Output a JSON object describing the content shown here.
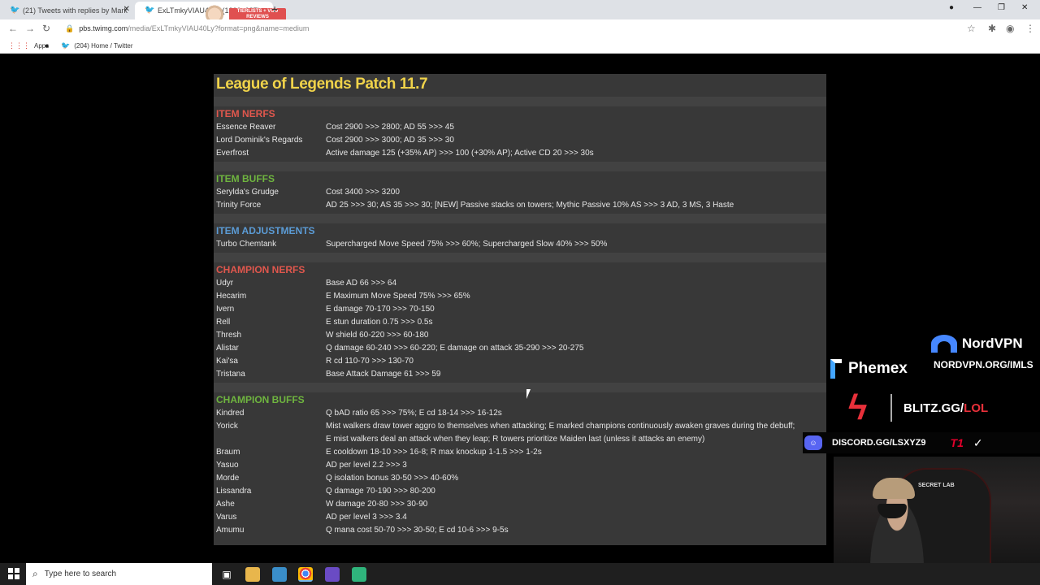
{
  "browser": {
    "tabs": [
      {
        "label": "(21) Tweets with replies by Mark",
        "active": false
      },
      {
        "label": "ExLTmkyVIAU40Ly (1200×987)",
        "active": true
      }
    ],
    "promo_text": "TIERLISTS + VOD REVIEWS",
    "url_host": "pbs.twimg.com",
    "url_path": "/media/ExLTmkyVIAU40Ly?format=png&name=medium",
    "bookmarks": [
      {
        "label": "Apps",
        "icon": "apps-grid-icon"
      },
      {
        "label": "",
        "icon": "extension-icon"
      },
      {
        "label": "(204) Home / Twitter",
        "icon": "twitter-icon"
      }
    ]
  },
  "sheet": {
    "title": "League of Legends Patch 11.7",
    "sections": [
      {
        "heading": "ITEM NERFS",
        "color": "#e0574d",
        "rows": [
          {
            "name": "Essence Reaver",
            "change": "Cost 2900 >>> 2800; AD 55 >>> 45"
          },
          {
            "name": "Lord Dominik's Regards",
            "change": "Cost 2900 >>> 3000; AD 35 >>> 30"
          },
          {
            "name": "Everfrost",
            "change": "Active damage 125 (+35% AP) >>> 100 (+30% AP); Active CD 20 >>> 30s"
          }
        ]
      },
      {
        "heading": "ITEM BUFFS",
        "color": "#6fb53f",
        "rows": [
          {
            "name": "Serylda's Grudge",
            "change": "Cost 3400 >>> 3200"
          },
          {
            "name": "Trinity Force",
            "change": "AD 25 >>> 30; AS 35 >>> 30; [NEW] Passive stacks on towers; Mythic Passive 10% AS >>> 3 AD, 3 MS, 3 Haste"
          }
        ]
      },
      {
        "heading": "ITEM ADJUSTMENTS",
        "color": "#5b9bd5",
        "rows": [
          {
            "name": "Turbo Chemtank",
            "change": "Supercharged Move Speed 75% >>> 60%; Supercharged Slow 40% >>> 50%"
          }
        ]
      },
      {
        "heading": "CHAMPION NERFS",
        "color": "#e0574d",
        "rows": [
          {
            "name": "Udyr",
            "change": "Base AD 66 >>> 64"
          },
          {
            "name": "Hecarim",
            "change": "E Maximum Move Speed 75% >>> 65%"
          },
          {
            "name": "Ivern",
            "change": "E damage 70-170 >>> 70-150"
          },
          {
            "name": "Rell",
            "change": "E stun duration 0.75 >>> 0.5s"
          },
          {
            "name": "Thresh",
            "change": "W shield 60-220 >>> 60-180"
          },
          {
            "name": "Alistar",
            "change": "Q damage 60-240 >>> 60-220; E damage on attack 35-290 >>> 20-275"
          },
          {
            "name": "Kai'sa",
            "change": "R cd 110-70 >>> 130-70"
          },
          {
            "name": "Tristana",
            "change": "Base Attack Damage 61 >>> 59"
          }
        ]
      },
      {
        "heading": "CHAMPION BUFFS",
        "color": "#6fb53f",
        "rows": [
          {
            "name": "Kindred",
            "change": "Q bAD ratio 65 >>> 75%; E cd 18-14 >>> 16-12s"
          },
          {
            "name": "Yorick",
            "change": "Mist walkers draw tower aggro to themselves when attacking; E marked champions continuously awaken graves during the debuff;"
          },
          {
            "name": "",
            "change": "E mist walkers deal an attack when they leap; R towers prioritize Maiden last (unless it attacks an enemy)"
          },
          {
            "name": "Braum",
            "change": "E cooldown 18-10 >>> 16-8; R max knockup 1-1.5 >>> 1-2s"
          },
          {
            "name": "Yasuo",
            "change": "AD per level 2.2 >>> 3"
          },
          {
            "name": "Morde",
            "change": "Q isolation bonus 30-50 >>> 40-60%"
          },
          {
            "name": "Lissandra",
            "change": "Q damage 70-190 >>> 80-200"
          },
          {
            "name": "Ashe",
            "change": "W damage 20-80 >>> 30-90"
          },
          {
            "name": "Varus",
            "change": "AD per level 3 >>> 3.4"
          },
          {
            "name": "Amumu",
            "change": "Q mana cost 50-70 >>> 30-50; E cd 10-6 >>> 9-5s"
          }
        ]
      }
    ]
  },
  "overlay": {
    "nord_brand": "NordVPN",
    "nord_url": "NORDVPN.ORG/IMLS",
    "phemex_brand": "Phemex",
    "blitz_prefix": "BLITZ.GG/",
    "blitz_suffix": "LOL",
    "discord_label": "DISCORD.GG/LSXYZ9",
    "sponsor_t1": "T1",
    "chair_logo": "SECRET LAB"
  },
  "taskbar": {
    "search_placeholder": "Type here to search",
    "apps": [
      "task-view-icon",
      "file-explorer-icon",
      "app-icon",
      "chrome-icon",
      "stream-app-icon",
      "chat-app-icon"
    ]
  }
}
